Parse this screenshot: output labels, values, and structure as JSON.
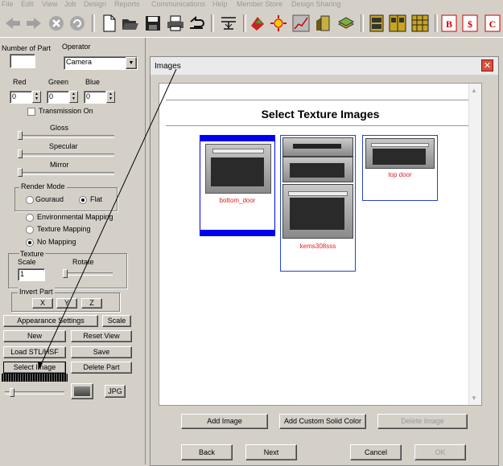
{
  "menu": [
    "File",
    "Edit",
    "View",
    "Job",
    "Design",
    "Reports",
    "Communications",
    "Help",
    "Member Store",
    "Design Sharing"
  ],
  "left": {
    "number_of_part_label": "Number of Part",
    "number_of_part_value": "",
    "operator_label": "Operator",
    "operator_value": "Camera",
    "red_label": "Red",
    "red_value": "0",
    "green_label": "Green",
    "green_value": "0",
    "blue_label": "Blue",
    "blue_value": "0",
    "transmission_label": "Transmission On",
    "gloss_label": "Gloss",
    "specular_label": "Specular",
    "mirror_label": "Mirror",
    "render_mode_label": "Render Mode",
    "gouraud_label": "Gouraud",
    "flat_label": "Flat",
    "env_mapping_label": "Environmental Mapping",
    "texture_mapping_label": "Texture Mapping",
    "no_mapping_label": "No Mapping",
    "texture_label": "Texture",
    "scale_label": "Scale",
    "scale_value": "1",
    "rotate_label": "Rotate",
    "invert_part_label": "Invert Part",
    "x_label": "X",
    "y_label": "Y",
    "z_label": "Z",
    "appearance_settings_label": "Appearance Settings",
    "scale_button_label": "Scale",
    "new_label": "New",
    "reset_view_label": "Reset View",
    "load_stl_label": "Load STL/HSF",
    "save_label": "Save",
    "select_image_label": "Select Image",
    "delete_part_label": "Delete Part",
    "jpg_label": "JPG"
  },
  "dialog": {
    "title": "Images",
    "heading": "Select Texture Images",
    "images": [
      {
        "label": "bottom_door",
        "selected": true
      },
      {
        "label": "kems308sss",
        "selected": false
      },
      {
        "label": "top door",
        "selected": false
      }
    ],
    "add_image_label": "Add Image",
    "add_custom_solid_color_label": "Add Custom Solid Color",
    "delete_image_label": "Delete Image",
    "back_label": "Back",
    "next_label": "Next",
    "cancel_label": "Cancel",
    "ok_label": "OK"
  },
  "colors": {
    "selection": "#0000ee",
    "thumb_border": "#2244cc",
    "label_red": "#e02020"
  }
}
